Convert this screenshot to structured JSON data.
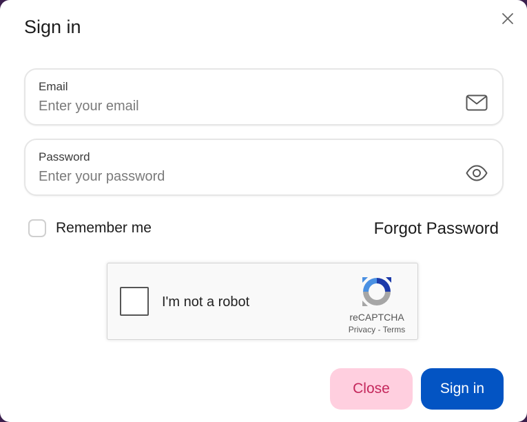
{
  "dialog": {
    "title": "Sign in"
  },
  "email": {
    "label": "Email",
    "placeholder": "Enter your email",
    "value": "",
    "icon": "mail-icon"
  },
  "password": {
    "label": "Password",
    "placeholder": "Enter your password",
    "value": "",
    "icon": "eye-icon"
  },
  "remember": {
    "label": "Remember me",
    "checked": false
  },
  "forgot": {
    "label": "Forgot Password"
  },
  "recaptcha": {
    "label": "I'm not a robot",
    "brand": "reCAPTCHA",
    "privacy": "Privacy",
    "separator": "-",
    "terms": "Terms"
  },
  "actions": {
    "close_label": "Close",
    "signin_label": "Sign in"
  },
  "colors": {
    "primary": "#0354c3",
    "close_bg": "#ffcfdf",
    "close_text": "#c4275b"
  }
}
